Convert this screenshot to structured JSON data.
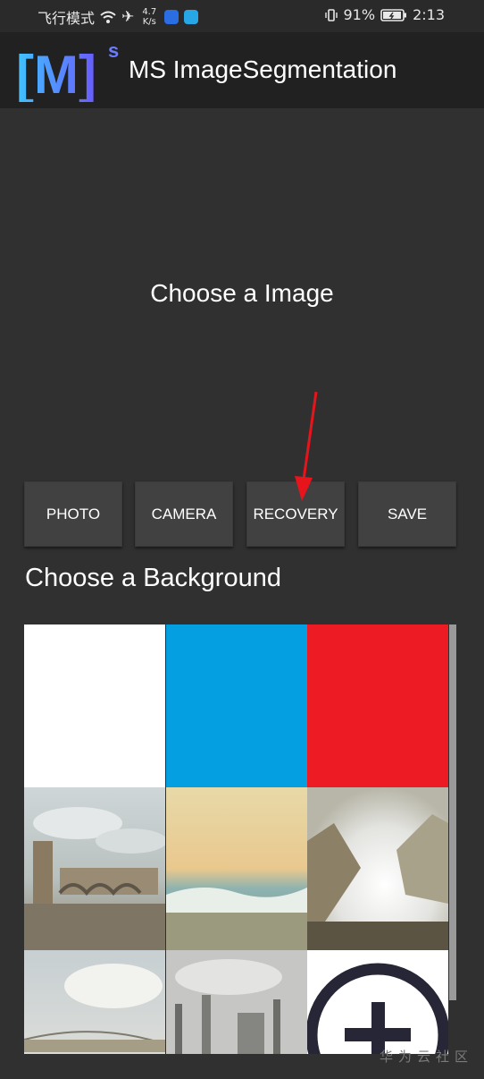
{
  "status_bar": {
    "carrier": "飞行模式",
    "speed_value": "4.7",
    "speed_unit": "K/s",
    "battery": "91%",
    "time": "2:13"
  },
  "app_bar": {
    "title": "MS ImageSegmentation",
    "logo_text": "[M]",
    "logo_sup": "s"
  },
  "main": {
    "image_prompt": "Choose a Image",
    "buttons": [
      "PHOTO",
      "CAMERA",
      "RECOVERY",
      "SAVE"
    ],
    "background_prompt": "Choose a Background"
  },
  "backgrounds": {
    "solid_colors": [
      "#ffffff",
      "#049fe0",
      "#ed1c24"
    ]
  },
  "watermark": "华为云社区"
}
